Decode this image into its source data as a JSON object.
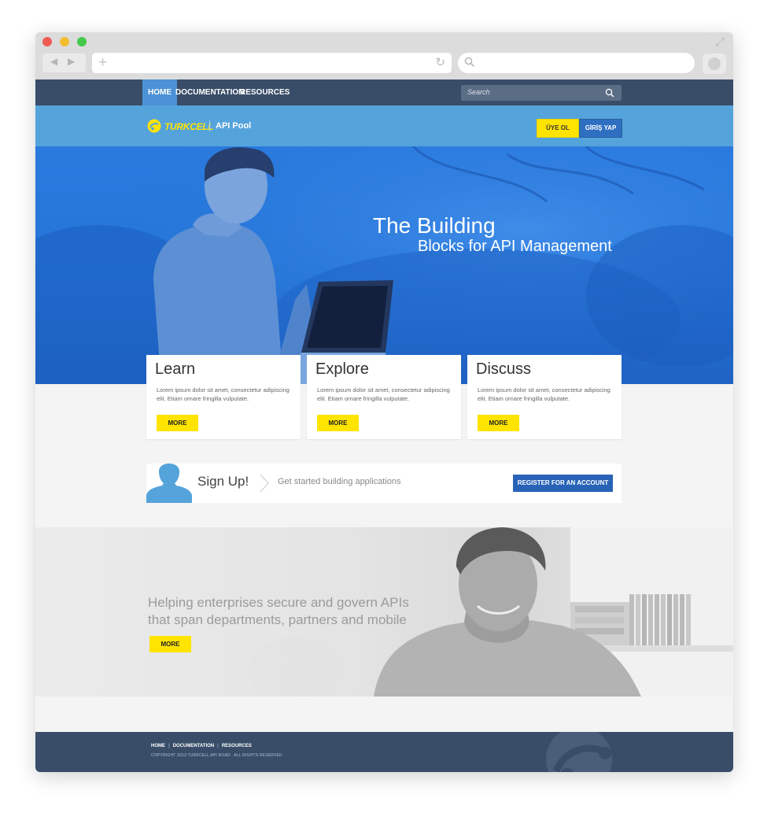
{
  "nav": {
    "home": "HOME",
    "documentation": "DOCUMENTATION",
    "resources": "RESOURCES",
    "search_placeholder": "Search"
  },
  "brand": {
    "logo_text": "TURKCELL",
    "product": "API Pool",
    "uye_ol": "ÜYE OL",
    "giris_yap": "GİRİŞ YAP"
  },
  "hero": {
    "title_line1": "The Building",
    "title_line2": "Blocks for API Management"
  },
  "cards": [
    {
      "title": "Learn",
      "body": "Lorem ipsum dolor sit amet, consectetur adipiscing elit. Etiam ornare fringilla vulputate.",
      "button": "MORE"
    },
    {
      "title": "Explore",
      "body": "Lorem ipsum dolor sit amet, consectetur adipiscing elit. Etiam ornare fringilla vulputate.",
      "button": "MORE"
    },
    {
      "title": "Discuss",
      "body": "Lorem ipsum dolor sit amet, consectetur adipiscing elit. Etiam ornare fringilla vulputate.",
      "button": "MORE"
    }
  ],
  "signup": {
    "title": "Sign Up!",
    "subtitle": "Get started building applications",
    "button": "REGISTER FOR AN ACCOUNT"
  },
  "enterprise": {
    "line1": "Helping enterprises secure and govern APIs",
    "line2": "that span departments, partners and mobile",
    "button": "MORE"
  },
  "footer": {
    "home": "HOME",
    "documentation": "DOCUMENTATION",
    "resources": "RESOURCES",
    "copyright": "COPYRIGHT 2013 TURKCELL API ROAD . ALL RIGHTS RESERVED"
  },
  "colors": {
    "nav_bg": "#394d68",
    "brand_bar": "#55a3db",
    "accent_yellow": "#ffe400",
    "accent_blue": "#2863b7",
    "hero_blue": "#2575d8"
  },
  "icons": [
    "back-icon",
    "forward-icon",
    "plus-icon",
    "reload-icon",
    "search-icon",
    "expand-icon",
    "turkcell-logo-icon",
    "user-silhouette-icon",
    "chevron-right-icon"
  ]
}
